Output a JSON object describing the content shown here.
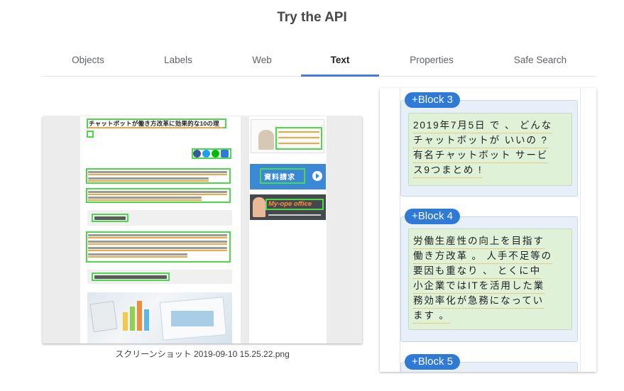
{
  "page": {
    "title": "Try the API"
  },
  "tabs": [
    {
      "label": "Objects",
      "active": false
    },
    {
      "label": "Labels",
      "active": false
    },
    {
      "label": "Web",
      "active": false
    },
    {
      "label": "Text",
      "active": true
    },
    {
      "label": "Properties",
      "active": false
    },
    {
      "label": "Safe Search",
      "active": false
    }
  ],
  "preview": {
    "filename": "スクリーンショット 2019-09-10 15.25.22.png",
    "article_title": "チャットボットが働き方改革に効果的な10の理",
    "ad_button_text": "資料請求",
    "ad_banner_text": "My-ope office"
  },
  "blocks": [
    {
      "label": "+Block 3",
      "lines": [
        "2019年7月5日 で 、 どんな",
        "チャットボットが いいの ?",
        " 有名チャットボット サービ",
        "ス9つまとめ !"
      ]
    },
    {
      "label": "+Block 4",
      "lines": [
        " 労働生産性の向上を目指す",
        "働き方改革 。 人手不足等の",
        "要因も重なり 、 とくに中",
        " 小企業ではITを活用した業",
        "務効率化が急務になってい",
        "ます 。"
      ]
    },
    {
      "label": "+Block 5",
      "lines": []
    }
  ],
  "colors": {
    "accent": "#4a78e0",
    "badge": "#2f7ad6",
    "detection_box": "#4bd94b",
    "paragraph_bg": "#dff2d8",
    "block_bg": "#e7f0f8"
  }
}
